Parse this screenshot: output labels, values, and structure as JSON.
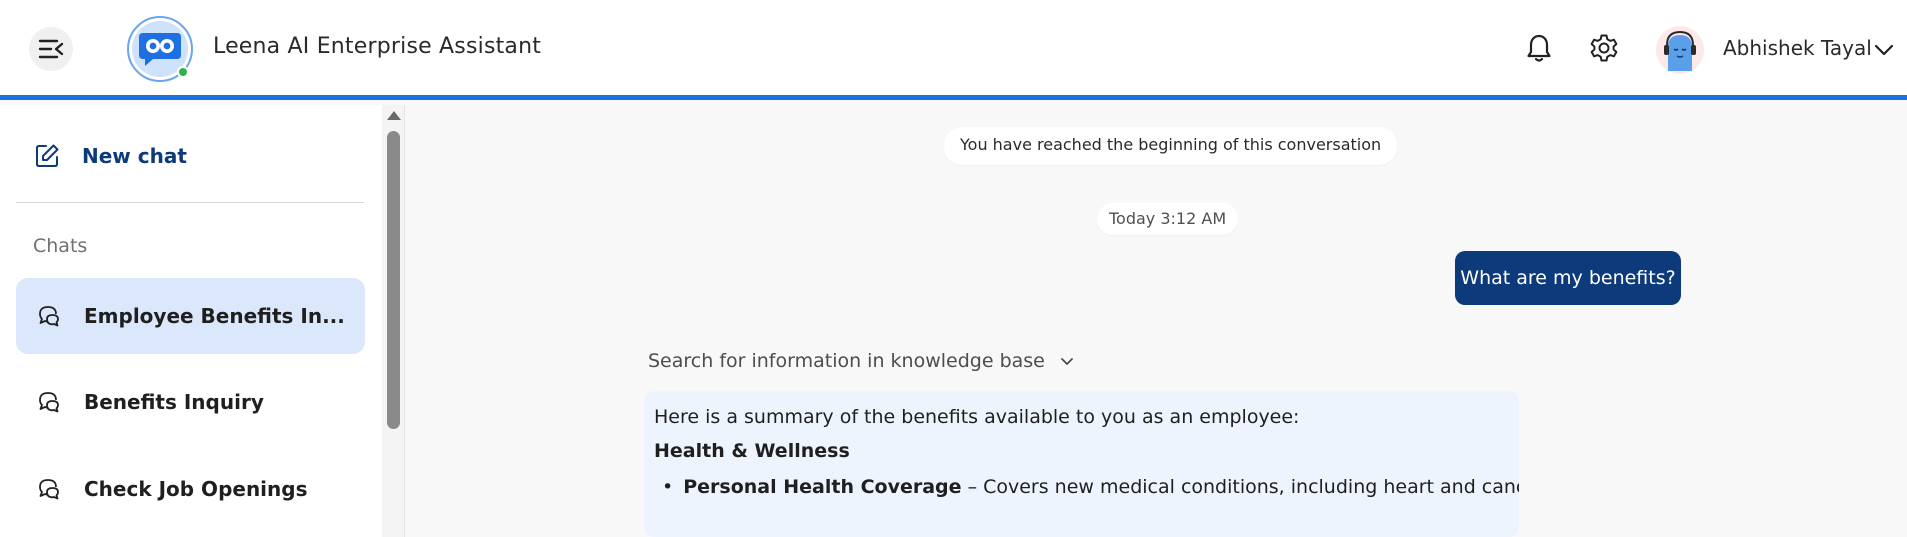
{
  "header": {
    "app_title": "Leena AI Enterprise Assistant",
    "user_name": "Abhishek Tayal",
    "icons": [
      "menu-collapse-icon",
      "bell-icon",
      "gear-icon",
      "chevron-down-icon"
    ],
    "accent_color": "#1e6fe0",
    "online_status_color": "#2cb34a"
  },
  "sidebar": {
    "new_chat_label": "New chat",
    "chats_heading": "Chats",
    "items": [
      {
        "label": "Employee Benefits In...",
        "active": true
      },
      {
        "label": "Benefits Inquiry",
        "active": false
      },
      {
        "label": "Check Job Openings",
        "active": false
      }
    ]
  },
  "conversation": {
    "beginning_notice": "You have reached the beginning of this conversation",
    "timestamp": "Today 3:12 AM",
    "user_message": "What are my benefits?",
    "tool_step_label": "Search for information in knowledge base",
    "answer": {
      "intro": "Here is a summary of the benefits available to you as an employee:",
      "heading": "Health & Wellness",
      "bullet_title": "Personal Health Coverage",
      "bullet_text": " – Covers new medical conditions, including heart and cancer car"
    }
  },
  "colors": {
    "primary_dark": "#0d3a7a",
    "active_chat_bg": "#dbe8fb",
    "answer_bg": "#eef4fd"
  }
}
